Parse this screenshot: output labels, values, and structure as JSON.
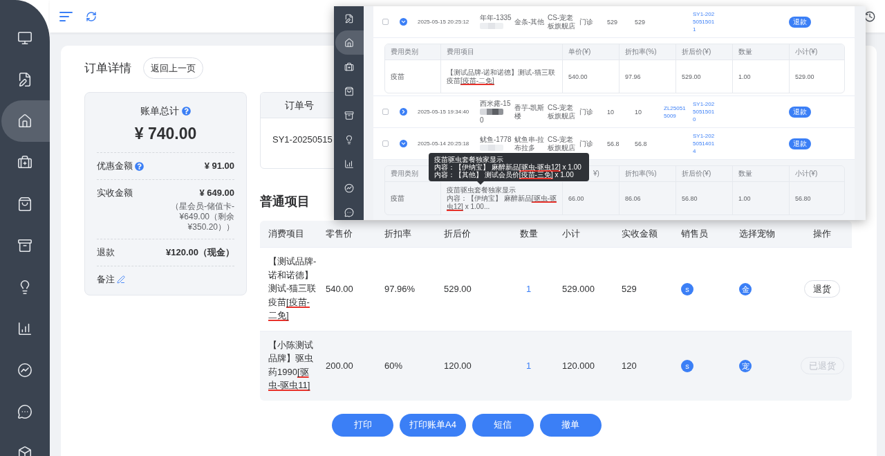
{
  "sidebar": {
    "items": [
      {
        "selected": false
      },
      {
        "selected": false
      },
      {
        "selected": true
      },
      {
        "selected": false
      },
      {
        "selected": false
      },
      {
        "selected": false
      },
      {
        "selected": false
      },
      {
        "selected": false
      },
      {
        "selected": false
      },
      {
        "selected": false
      },
      {
        "selected": false
      }
    ]
  },
  "page": {
    "title": "订单详情",
    "back_button": "返回上一页"
  },
  "bill_summary": {
    "title": "账单总计",
    "help": true,
    "total": "¥ 740.00",
    "rows": [
      {
        "label": "优惠金额",
        "help": true,
        "editable": false,
        "value": "¥ 91.00"
      },
      {
        "label": "实收金额",
        "help": false,
        "editable": false,
        "value": "¥ 649.00",
        "note": "（星会员-储值卡-¥649.00（剩余¥350.20））"
      },
      {
        "label": "退款",
        "help": false,
        "editable": false,
        "value": "¥120.00（现金）"
      },
      {
        "label": "备注",
        "help": false,
        "editable": true
      }
    ]
  },
  "order_info": {
    "columns": [
      {
        "header": "订单号",
        "value": "SY1-20250515"
      }
    ]
  },
  "items_section": {
    "title": "普通项目",
    "columns": [
      "消费项目",
      "零售价",
      "折扣率",
      "折后价",
      "数量",
      "小计",
      "实收金额",
      "销售员",
      "选择宠物",
      "操作"
    ],
    "rows": [
      {
        "item": {
          "text": "【测试品牌-诺和诺德】测试-猫三联疫苗",
          "marked": "[疫苗-二免]"
        },
        "retail_price": "540.00",
        "discount_rate": "97.96%",
        "discounted_price": "529.00",
        "quantity": "1",
        "subtotal": "529.000",
        "received": "529",
        "salesperson": "s",
        "pet": "金",
        "action": {
          "label": "退货",
          "disabled": false
        }
      },
      {
        "item": {
          "text": "【小陈测试品牌】驱虫药1990",
          "marked": "[驱虫-驱虫11]"
        },
        "retail_price": "200.00",
        "discount_rate": "60%",
        "discounted_price": "120.00",
        "quantity": "1",
        "subtotal": "120.000",
        "received": "120",
        "salesperson": "s",
        "pet": "宠",
        "action": {
          "label": "已退货",
          "disabled": true
        }
      }
    ]
  },
  "actions": [
    "打印",
    "打印账单A4",
    "短信",
    "撤单"
  ],
  "screenshot": {
    "sidebar": {
      "items": [
        {
          "selected": false
        },
        {
          "selected": true
        },
        {
          "selected": false
        },
        {
          "selected": false
        },
        {
          "selected": false
        },
        {
          "selected": false
        },
        {
          "selected": false
        },
        {
          "selected": false
        },
        {
          "selected": false
        }
      ]
    },
    "rows": [
      {
        "kind": "order",
        "checked": false,
        "expanded": true,
        "column_3": "2025-05-15 20:25:12",
        "column_4": {
          "text": "年年-1335",
          "dark": false
        },
        "column_5": "金条-其他",
        "column_6": "CS-宠老板旗舰店",
        "column_7": "门诊",
        "column_8": "529",
        "column_9": "529",
        "column_11": "SY1-20250515011",
        "action": "退款"
      },
      {
        "kind": "detail",
        "highlighted": false,
        "columns": [
          "费用类别",
          "费用项目",
          "单价(¥)",
          "折扣率(%)",
          "折后价(¥)",
          "数量",
          "小计(¥)"
        ],
        "cells": [
          "疫苗",
          {
            "text": "【测试品牌-诺和诺德】测试-猫三联疫苗",
            "marked": "[疫苗-二免]"
          },
          "540.00",
          "97.96",
          "529.00",
          "1.00",
          "529.00"
        ]
      },
      {
        "kind": "order",
        "checked": false,
        "expanded": false,
        "column_3": "2025-05-15 19:34:40",
        "column_4": {
          "text": "西米露-15",
          "dark": true,
          "end": "0"
        },
        "column_5": "香芋-凯斯楼",
        "column_6": "CS-宠老板旗舰店",
        "column_7": "门诊",
        "column_8": "10",
        "column_9": "10",
        "column_10": "ZL250515009",
        "column_11": "SY1-20250515010",
        "action": "退款"
      },
      {
        "kind": "order",
        "checked": false,
        "expanded": true,
        "column_3": "2025-05-14 20:25:18",
        "column_4": {
          "text": "鱿鱼-1778",
          "dark": false
        },
        "column_5": "鱿鱼串-拉布拉多",
        "column_6": "CS-宠老板旗舰店",
        "column_7": "门诊",
        "column_8": "56.8",
        "column_9": "56.8",
        "column_11": "SY1-20250514014",
        "action": "退款"
      },
      {
        "kind": "detail",
        "highlighted": true,
        "columns": [
          "费用类别",
          null,
          "¥)",
          "折扣率(%)",
          "折后价(¥)",
          "数量",
          "小计(¥)"
        ],
        "cells": [
          "疫苗",
          {
            "title": "疫苗驱虫套餐独家显示",
            "text": "内容：【伊纳宝】 麻醉新品",
            "marked": "[驱虫-驱虫12]",
            "after": " x 1.00..."
          },
          "66.00",
          "86.06",
          "56.80",
          "1.00",
          "56.80"
        ],
        "tooltip": {
          "title": "疫苗驱虫套餐独家显示",
          "lines": [
            {
              "text": "内容：【伊纳宝】 麻醉新品",
              "marked": "[驱虫-驱虫12]",
              "after": " x 1.00"
            },
            {
              "text": "内容：【其他】 测试会员价",
              "marked": "[疫苗-三免]",
              "after": " x 1.00"
            }
          ]
        }
      }
    ]
  }
}
